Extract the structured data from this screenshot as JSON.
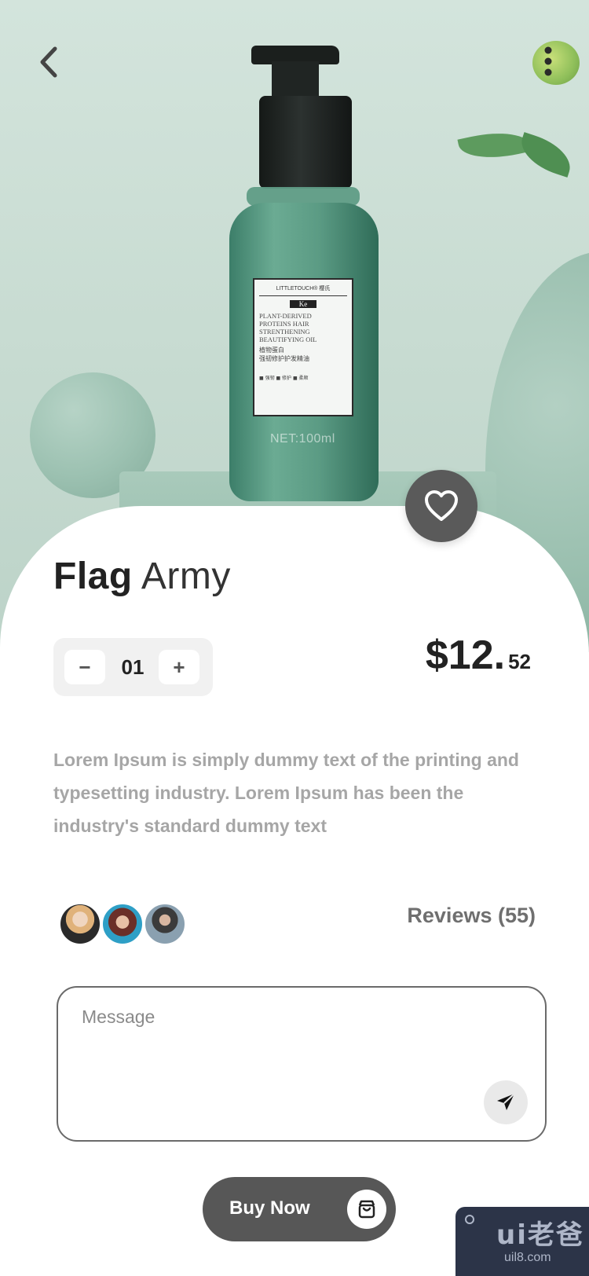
{
  "product": {
    "label": {
      "brand": "LITTLETOUCH® 樱氏",
      "code": "Ke",
      "name_lines": [
        "PLANT-DERIVED",
        "PROTEINS HAIR",
        "STRENTHENING",
        "BEAUTIFYING OIL"
      ],
      "cn_lines": [
        "植物蛋白",
        "强韧修护护发精油"
      ],
      "features": "■ 强韧  ■ 修护  ■ 柔顺",
      "net": "NET:100ml"
    },
    "title_bold": "Flag",
    "title_light": "Army",
    "quantity": "01",
    "minus_label": "−",
    "plus_label": "+",
    "price_main": "$12.",
    "price_cents": "52",
    "description": "Lorem Ipsum is simply dummy text of the printing and typesetting industry. Lorem Ipsum has been the industry's standard dummy text"
  },
  "reviews": {
    "label": "Reviews (55)"
  },
  "message": {
    "placeholder": "Message"
  },
  "buy": {
    "label": "Buy Now"
  },
  "watermark": {
    "logo": "ui老爸",
    "url": "uil8.com"
  },
  "icons": {
    "back": "chevron-left-icon",
    "menu": "more-vertical-icon",
    "favorite": "heart-icon",
    "send": "send-icon",
    "cart": "shopping-bag-icon"
  },
  "colors": {
    "accent_dark": "#575757",
    "hero_bg": "#c7dbd1",
    "text_primary": "#222222",
    "text_muted": "#a6a6a6"
  }
}
